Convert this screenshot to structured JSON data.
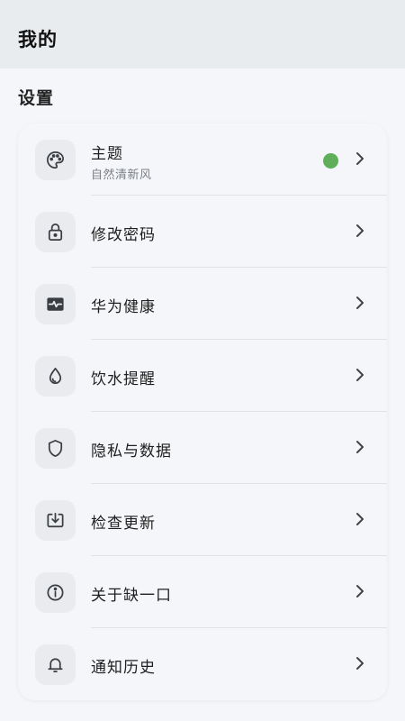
{
  "header": {
    "title": "我的"
  },
  "settings": {
    "section_title": "设置",
    "items": [
      {
        "label": "主题",
        "subtitle": "自然清新风",
        "icon": "palette-icon",
        "indicator_color": "#5fae5a"
      },
      {
        "label": "修改密码",
        "icon": "lock-icon"
      },
      {
        "label": "华为健康",
        "icon": "health-monitor-icon"
      },
      {
        "label": "饮水提醒",
        "icon": "water-drop-icon"
      },
      {
        "label": "隐私与数据",
        "icon": "shield-icon"
      },
      {
        "label": "检查更新",
        "icon": "download-update-icon"
      },
      {
        "label": "关于缺一口",
        "icon": "info-icon"
      },
      {
        "label": "通知历史",
        "icon": "bell-icon"
      }
    ]
  }
}
